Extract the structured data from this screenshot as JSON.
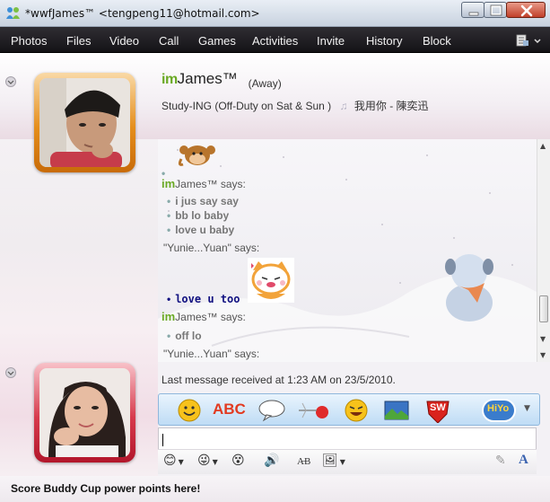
{
  "window": {
    "title": "*wwfJames™ <tengpeng11@hotmail.com>"
  },
  "menu": {
    "items": [
      "Photos",
      "Files",
      "Video",
      "Call",
      "Games",
      "Activities",
      "Invite",
      "History",
      "Block"
    ]
  },
  "contact": {
    "logo": "im",
    "name": "James™",
    "status": "(Away)",
    "psm": "Study-ING (Off-Duty on Sat & Sun )",
    "music": "我用你 - 陳奕迅"
  },
  "conversation": {
    "lines": [
      {
        "kind": "speaker",
        "logo": "im",
        "text": "James™ says:"
      },
      {
        "kind": "message",
        "text": "i jus say say"
      },
      {
        "kind": "message",
        "text": "bb lo baby"
      },
      {
        "kind": "message",
        "text": "love u baby"
      },
      {
        "kind": "speaker",
        "logo": "",
        "text": "\"Yunie...Yuan\" says:"
      },
      {
        "kind": "styled",
        "text": "love u too"
      },
      {
        "kind": "speaker",
        "logo": "im",
        "text": "James™ says:"
      },
      {
        "kind": "message",
        "text": "off lo"
      },
      {
        "kind": "speaker",
        "logo": "",
        "text": "\"Yunie...Yuan\" says:"
      }
    ],
    "last_received": "Last message received at 1:23 AM on 23/5/2010."
  },
  "toolbar": {
    "winks": [
      "smiley-wink",
      "abc-wink",
      "speech-bubble-wink",
      "kiss-wink",
      "laughing-wink",
      "picture-wink",
      "sw-wink",
      "hiyo-wink"
    ],
    "abc_label": "ABC",
    "sw_label": "SW",
    "hiyo_label": "HiYo"
  },
  "input": {
    "value": ""
  },
  "footer": {
    "link": "Score Buddy Cup power points here!"
  },
  "colors": {
    "im_green": "#6aa924",
    "menu_bg": "#1e1d21",
    "my_frame": "#e58e1c",
    "buddy_frame": "#d73a4d",
    "winkbar": "#cfe5f8"
  }
}
